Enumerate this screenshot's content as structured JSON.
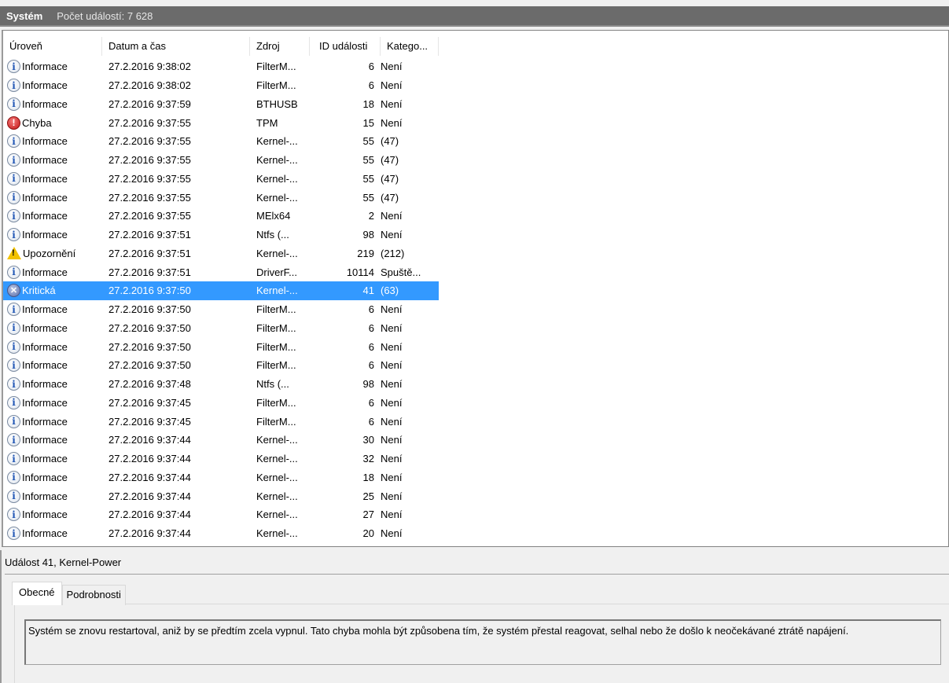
{
  "header": {
    "title": "Systém",
    "count": "Počet událostí: 7 628"
  },
  "columns": [
    "Úroveň",
    "Datum a čas",
    "Zdroj",
    "ID události",
    "Katego..."
  ],
  "rows": [
    {
      "icon": "info",
      "level": "Informace",
      "date": "27.2.2016 9:38:02",
      "source": "FilterM...",
      "id": "6",
      "category": "Není"
    },
    {
      "icon": "info",
      "level": "Informace",
      "date": "27.2.2016 9:38:02",
      "source": "FilterM...",
      "id": "6",
      "category": "Není"
    },
    {
      "icon": "info",
      "level": "Informace",
      "date": "27.2.2016 9:37:59",
      "source": "BTHUSB",
      "id": "18",
      "category": "Není"
    },
    {
      "icon": "error",
      "level": "Chyba",
      "date": "27.2.2016 9:37:55",
      "source": "TPM",
      "id": "15",
      "category": "Není"
    },
    {
      "icon": "info",
      "level": "Informace",
      "date": "27.2.2016 9:37:55",
      "source": "Kernel-...",
      "id": "55",
      "category": "(47)"
    },
    {
      "icon": "info",
      "level": "Informace",
      "date": "27.2.2016 9:37:55",
      "source": "Kernel-...",
      "id": "55",
      "category": "(47)"
    },
    {
      "icon": "info",
      "level": "Informace",
      "date": "27.2.2016 9:37:55",
      "source": "Kernel-...",
      "id": "55",
      "category": "(47)"
    },
    {
      "icon": "info",
      "level": "Informace",
      "date": "27.2.2016 9:37:55",
      "source": "Kernel-...",
      "id": "55",
      "category": "(47)"
    },
    {
      "icon": "info",
      "level": "Informace",
      "date": "27.2.2016 9:37:55",
      "source": "MElx64",
      "id": "2",
      "category": "Není"
    },
    {
      "icon": "info",
      "level": "Informace",
      "date": "27.2.2016 9:37:51",
      "source": "Ntfs (...",
      "id": "98",
      "category": "Není"
    },
    {
      "icon": "warning",
      "level": "Upozornění",
      "date": "27.2.2016 9:37:51",
      "source": "Kernel-...",
      "id": "219",
      "category": "(212)"
    },
    {
      "icon": "info",
      "level": "Informace",
      "date": "27.2.2016 9:37:51",
      "source": "DriverF...",
      "id": "10114",
      "category": "Spuště..."
    },
    {
      "icon": "critical",
      "level": "Kritická",
      "date": "27.2.2016 9:37:50",
      "source": "Kernel-...",
      "id": "41",
      "category": "(63)",
      "selected": true
    },
    {
      "icon": "info",
      "level": "Informace",
      "date": "27.2.2016 9:37:50",
      "source": "FilterM...",
      "id": "6",
      "category": "Není"
    },
    {
      "icon": "info",
      "level": "Informace",
      "date": "27.2.2016 9:37:50",
      "source": "FilterM...",
      "id": "6",
      "category": "Není"
    },
    {
      "icon": "info",
      "level": "Informace",
      "date": "27.2.2016 9:37:50",
      "source": "FilterM...",
      "id": "6",
      "category": "Není"
    },
    {
      "icon": "info",
      "level": "Informace",
      "date": "27.2.2016 9:37:50",
      "source": "FilterM...",
      "id": "6",
      "category": "Není"
    },
    {
      "icon": "info",
      "level": "Informace",
      "date": "27.2.2016 9:37:48",
      "source": "Ntfs (...",
      "id": "98",
      "category": "Není"
    },
    {
      "icon": "info",
      "level": "Informace",
      "date": "27.2.2016 9:37:45",
      "source": "FilterM...",
      "id": "6",
      "category": "Není"
    },
    {
      "icon": "info",
      "level": "Informace",
      "date": "27.2.2016 9:37:45",
      "source": "FilterM...",
      "id": "6",
      "category": "Není"
    },
    {
      "icon": "info",
      "level": "Informace",
      "date": "27.2.2016 9:37:44",
      "source": "Kernel-...",
      "id": "30",
      "category": "Není"
    },
    {
      "icon": "info",
      "level": "Informace",
      "date": "27.2.2016 9:37:44",
      "source": "Kernel-...",
      "id": "32",
      "category": "Není"
    },
    {
      "icon": "info",
      "level": "Informace",
      "date": "27.2.2016 9:37:44",
      "source": "Kernel-...",
      "id": "18",
      "category": "Není"
    },
    {
      "icon": "info",
      "level": "Informace",
      "date": "27.2.2016 9:37:44",
      "source": "Kernel-...",
      "id": "25",
      "category": "Není"
    },
    {
      "icon": "info",
      "level": "Informace",
      "date": "27.2.2016 9:37:44",
      "source": "Kernel-...",
      "id": "27",
      "category": "Není"
    },
    {
      "icon": "info",
      "level": "Informace",
      "date": "27.2.2016 9:37:44",
      "source": "Kernel-...",
      "id": "20",
      "category": "Není"
    }
  ],
  "detail": {
    "title": "Událost 41, Kernel-Power",
    "tabs": [
      "Obecné",
      "Podrobnosti"
    ],
    "description": "Systém se znovu restartoval, aniž by se předtím zcela vypnul. Tato chyba mohla být způsobena tím, že systém přestal reagovat, selhal nebo že došlo k neočekávané ztrátě napájení."
  }
}
